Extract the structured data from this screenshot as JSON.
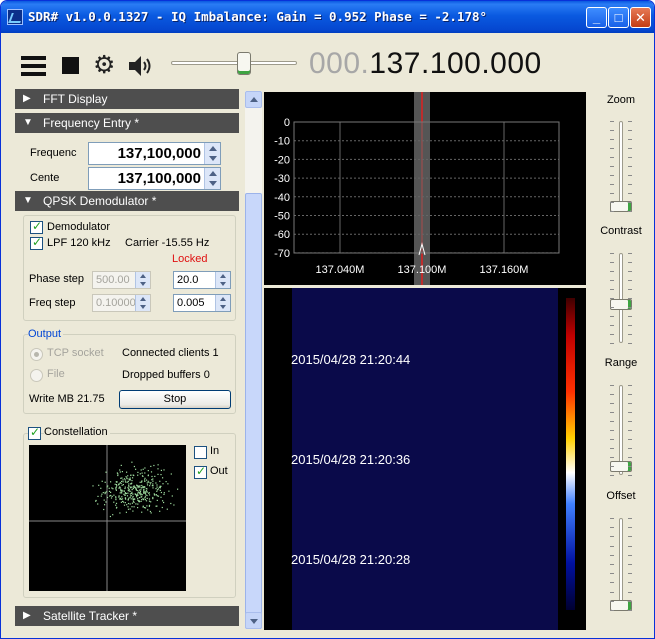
{
  "window": {
    "title": "SDR# v1.0.0.1327 - IQ Imbalance: Gain = 0.952 Phase = -2.178°",
    "minimize_label": "_",
    "maximize_label": "□",
    "close_label": "✕"
  },
  "toolbar": {
    "frequency_prefix": "000.",
    "frequency": "137.100.000",
    "volume_level": 0.55
  },
  "sections": {
    "fft_display": "FFT Display",
    "frequency_entry": "Frequency Entry *",
    "qpsk_demodulator": "QPSK Demodulator *",
    "satellite_tracker": "Satellite Tracker *"
  },
  "frequency_entry": {
    "frequency_label": "Frequenc",
    "frequency_value": "137,100,000",
    "center_label": "Cente",
    "center_value": "137,100,000"
  },
  "qpsk": {
    "demodulator_label": "Demodulator",
    "demodulator_checked": true,
    "lpf_label": "LPF 120 kHz",
    "lpf_checked": true,
    "carrier_text": "Carrier -15.55 Hz",
    "locked_text": "Locked",
    "phase_step_label": "Phase step",
    "phase_step_left": "500.00",
    "phase_step_right": "20.0",
    "freq_step_label": "Freq step",
    "freq_step_left": "0.10000",
    "freq_step_right": "0.005"
  },
  "output": {
    "group_label": "Output",
    "tcp_socket_label": "TCP socket",
    "file_label": "File",
    "connected_clients": "Connected clients 1",
    "dropped_buffers": "Dropped buffers 0",
    "write_mb": "Write MB 21.75",
    "stop_label": "Stop"
  },
  "constellation": {
    "label": "Constellation",
    "checked": true,
    "in_label": "In",
    "in_checked": false,
    "out_label": "Out",
    "out_checked": true
  },
  "spectrum": {
    "y_ticks": [
      "0",
      "-10",
      "-20",
      "-30",
      "-40",
      "-50",
      "-60",
      "-70"
    ],
    "x_ticks": [
      "137.040M",
      "137.100M",
      "137.160M"
    ]
  },
  "waterfall": {
    "timestamps": [
      "2015/04/28 21:20:44",
      "2015/04/28 21:20:36",
      "2015/04/28 21:20:28"
    ]
  },
  "right_controls": {
    "zoom_label": "Zoom",
    "zoom_level": 0.0,
    "contrast_label": "Contrast",
    "contrast_level": 0.4,
    "range_label": "Range",
    "range_level": 0.05,
    "offset_label": "Offset",
    "offset_level": 0.0
  },
  "colors": {
    "titlebar": "#0a5ae0",
    "section_header": "#4e4e4e",
    "locked": "#e01010",
    "output_label": "#0046d5",
    "waterfall_bg": "#0a0a4a",
    "tuned_line": "#e02020"
  }
}
